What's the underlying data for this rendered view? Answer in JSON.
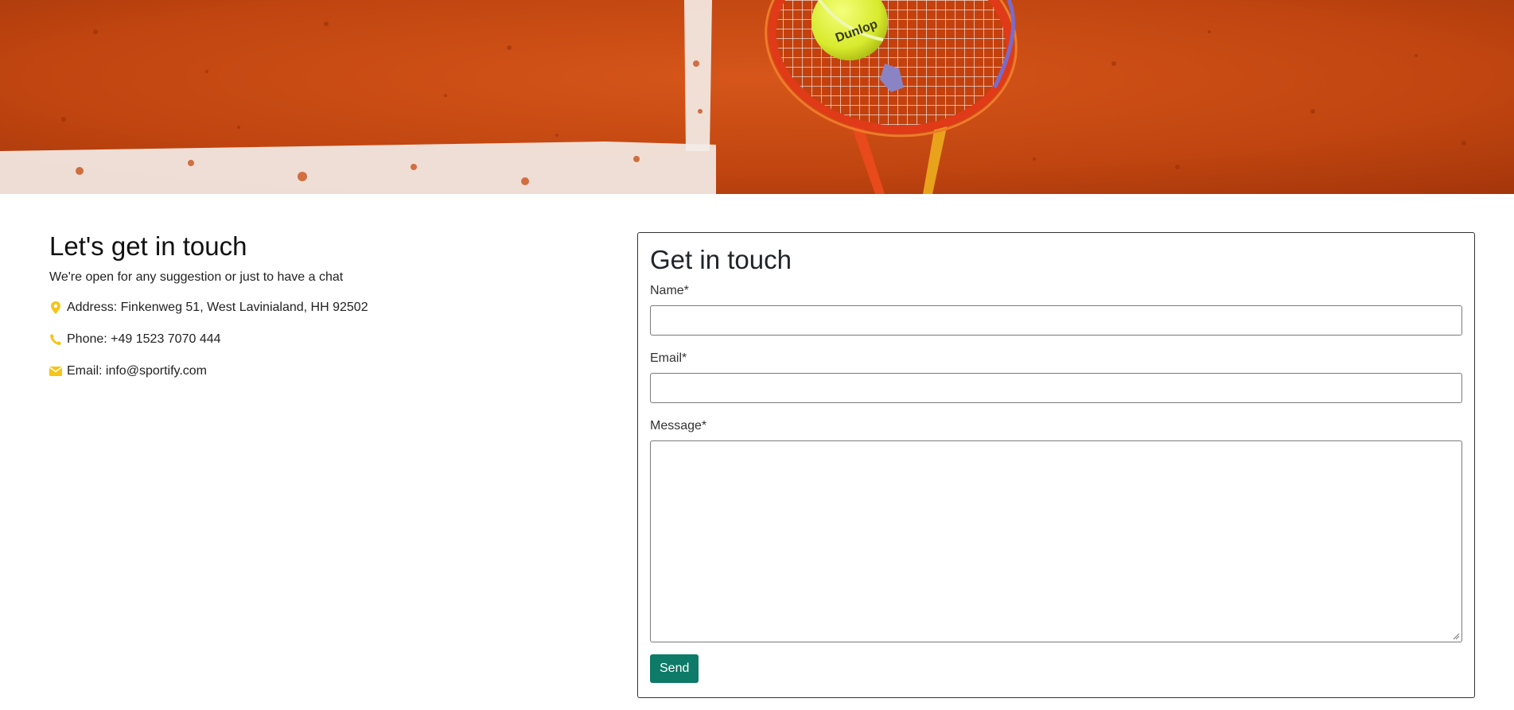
{
  "hero": {
    "image": "tennis-racket-on-clay-court",
    "ball_text": "Dunlop"
  },
  "contact_info": {
    "heading": "Let's get in touch",
    "subtitle": "We're open for any suggestion or just to have a chat",
    "address": "Address: Finkenweg 51, West Lavinialand, HH 92502",
    "phone": "Phone: +49 1523 7070 444",
    "email": "Email: info@sportify.com",
    "icons": [
      "map-marker-icon",
      "phone-icon",
      "envelope-icon"
    ],
    "icon_color": "#f5c518"
  },
  "form": {
    "heading": "Get in touch",
    "name_label": "Name*",
    "name_value": "",
    "email_label": "Email*",
    "email_value": "",
    "message_label": "Message*",
    "message_value": "",
    "submit_label": "Send",
    "submit_color": "#0e7a68"
  }
}
